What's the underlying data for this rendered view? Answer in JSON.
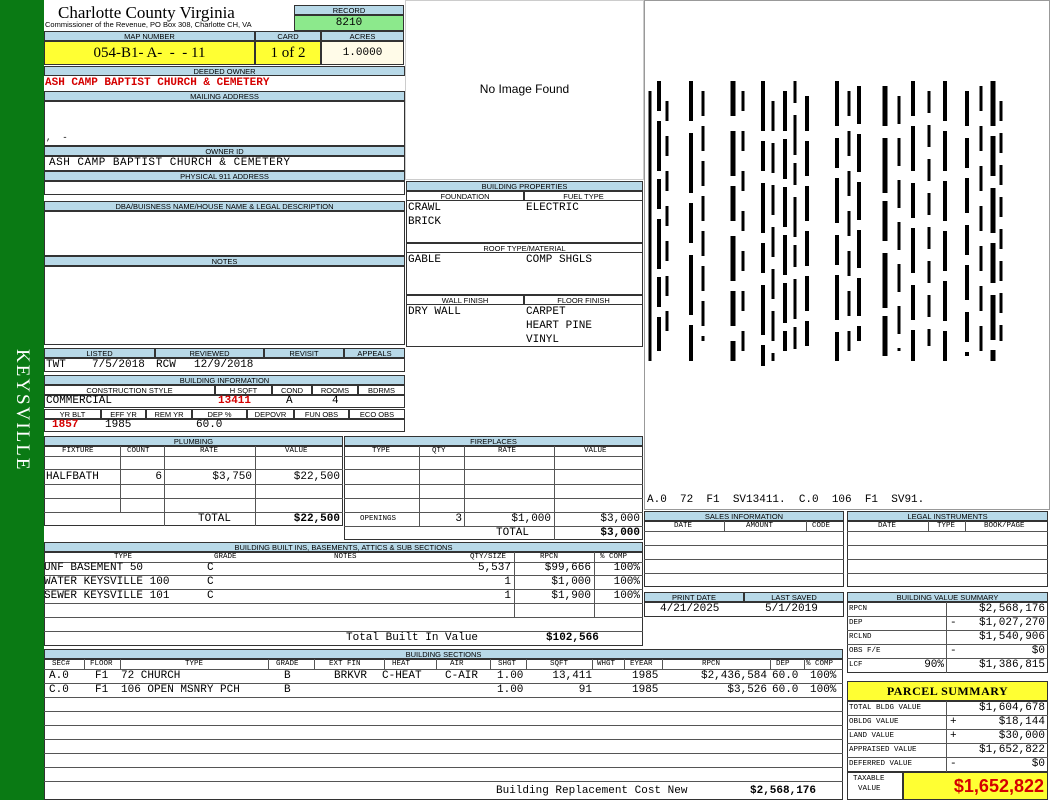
{
  "side": {
    "town": "KEYSVILLE"
  },
  "header": {
    "county": "Charlotte County Virginia",
    "address": "Commissioner of the Revenue, PO Box 308, Charlotte CH, VA",
    "record_label": "RECORD",
    "record": "8210",
    "map_label": "MAP NUMBER",
    "map": "054-B1- A-  -  - 11",
    "card_label": "CARD",
    "card": "1 of 2",
    "acres_label": "ACRES",
    "acres": "1.0000"
  },
  "owner": {
    "deeded_label": "DEEDED OWNER",
    "deeded": "ASH CAMP BAPTIST CHURCH & CEMETERY",
    "mailing_label": "MAILING ADDRESS",
    "mailing": ",  -",
    "owner_id_label": "OWNER ID",
    "owner_id": "ASH CAMP BAPTIST CHURCH & CEMETERY",
    "physical_label": "PHYSICAL 911 ADDRESS",
    "dba_label": "DBA/BUISNESS NAME/HOUSE NAME & LEGAL DESCRIPTION",
    "notes_label": "NOTES"
  },
  "photo": {
    "text": "No Image Found"
  },
  "sketch": {
    "caption": "A.0  72  F1  SV13411.  C.0  106  F1  SV91."
  },
  "props": {
    "title": "BUILDING PROPERTIES",
    "foundation_label": "FOUNDATION",
    "fuel_label": "FUEL TYPE",
    "foundation1": "CRAWL",
    "foundation2": "BRICK",
    "fuel": "ELECTRIC",
    "roof_label": "ROOF TYPE/MATERIAL",
    "roof1": "GABLE",
    "roof2": "COMP SHGLS",
    "wall_label": "WALL FINISH",
    "floor_label": "FLOOR FINISH",
    "wall": "DRY WALL",
    "floor1": "CARPET",
    "floor2": "HEART PINE",
    "floor3": "VINYL"
  },
  "visits": {
    "listed_label": "LISTED",
    "reviewed_label": "REVIEWED",
    "revisit_label": "REVISIT",
    "appeals_label": "APPEALS",
    "listed_by": "TWT",
    "listed": "7/5/2018",
    "reviewed_by": "RCW",
    "reviewed": "12/9/2018"
  },
  "binfo": {
    "title": "BUILDING INFORMATION",
    "style_label": "CONSTRUCTION STYLE",
    "hsqft_label": "H SQFT",
    "cond_label": "COND",
    "rooms_label": "ROOMS",
    "bdrms_label": "BDRMS",
    "style": "COMMERCIAL",
    "hsqft": "13411",
    "cond": "A",
    "rooms": "4",
    "yrblt_label": "YR BLT",
    "effyr_label": "EFF YR",
    "remyr_label": "REM YR",
    "dep_label": "DEP %",
    "depovr_label": "DEPOVR",
    "funobs_label": "FUN OBS",
    "ecoobs_label": "ECO OBS",
    "yrblt": "1857",
    "effyr": "1985",
    "dep": "60.0"
  },
  "plumbing": {
    "title": "PLUMBING",
    "cols": [
      "FIXTURE",
      "COUNT",
      "RATE",
      "VALUE"
    ],
    "fixture": "HALFBATH",
    "count": "6",
    "rate": "$3,750",
    "value": "$22,500",
    "total_label": "TOTAL",
    "total": "$22,500"
  },
  "fireplaces": {
    "title": "FIREPLACES",
    "cols": [
      "TYPE",
      "QTY",
      "RATE",
      "VALUE"
    ],
    "openings_label": "OPENINGS",
    "qty": "3",
    "rate": "$1,000",
    "value": "$3,000",
    "total_label": "TOTAL",
    "total": "$3,000"
  },
  "sales": {
    "title": "SALES INFORMATION",
    "cols": [
      "DATE",
      "AMOUNT",
      "CODE"
    ]
  },
  "legal": {
    "title": "LEGAL INSTRUMENTS",
    "cols": [
      "DATE",
      "TYPE",
      "BOOK/PAGE"
    ]
  },
  "dates": {
    "print_label": "PRINT DATE",
    "print": "4/21/2025",
    "saved_label": "LAST SAVED",
    "saved": "5/1/2019"
  },
  "builtins": {
    "title": "BUILDING BUILT INS, BASEMENTS, ATTICS & SUB SECTIONS",
    "cols": [
      "TYPE",
      "GRADE",
      "NOTES",
      "QTY/SIZE",
      "RPCN",
      "% COMP"
    ],
    "rows": [
      {
        "type": "50 UNF BASEMENT",
        "grade": "C",
        "qty": "5,537",
        "rpcn": "$99,666",
        "comp": "100%"
      },
      {
        "type": "100 WATER KEYSVILLE",
        "grade": "C",
        "qty": "1",
        "rpcn": "$1,000",
        "comp": "100%"
      },
      {
        "type": "101 SEWER KEYSVILLE",
        "grade": "C",
        "qty": "1",
        "rpcn": "$1,900",
        "comp": "100%"
      }
    ],
    "total_label": "Total Built In Value",
    "total": "$102,566"
  },
  "sections": {
    "title": "BUILDING SECTIONS",
    "cols": [
      "SEC#",
      "FLOOR",
      "TYPE",
      "GRADE",
      "EXT FIN",
      "HEAT",
      "AIR",
      "SHGT",
      "SQFT",
      "WHGT",
      "EYEAR",
      "RPCN",
      "DEP",
      "% COMP"
    ],
    "rows": [
      {
        "sec": "A.0",
        "floor": "F1",
        "type": "72 CHURCH",
        "grade": "B",
        "extfin": "BRKVR",
        "heat": "C-HEAT",
        "air": "C-AIR",
        "shgt": "1.00",
        "sqft": "13,411",
        "eyear": "1985",
        "rpcn": "$2,436,584",
        "dep": "60.0",
        "comp": "100%"
      },
      {
        "sec": "C.0",
        "floor": "F1",
        "type": "106 OPEN MSNRY PCH",
        "grade": "B",
        "extfin": "",
        "heat": "",
        "air": "",
        "shgt": "1.00",
        "sqft": "91",
        "eyear": "1985",
        "rpcn": "$3,526",
        "dep": "60.0",
        "comp": "100%"
      }
    ],
    "brcn_label": "Building Replacement Cost New",
    "brcn": "$2,568,176"
  },
  "bvs": {
    "title": "BUILDING VALUE SUMMARY",
    "rpcn_label": "RPCN",
    "rpcn": "$2,568,176",
    "dep_label": "DEP",
    "dep_sign": "-",
    "dep": "$1,027,270",
    "rclnd_label": "RCLND",
    "rclnd": "$1,540,906",
    "obs_label": "OBS F/E",
    "obs_sign": "-",
    "obs": "$0",
    "lcf_label": "LCF",
    "lcf_pct": "90%",
    "lcf": "$1,386,815"
  },
  "parcel": {
    "title": "PARCEL SUMMARY",
    "tbv_label": "TOTAL BLDG VALUE",
    "tbv": "$1,604,678",
    "obldg_label": "OBLDG VALUE",
    "obldg_sign": "+",
    "obldg": "$18,144",
    "land_label": "LAND VALUE",
    "land_sign": "+",
    "land": "$30,000",
    "appraised_label": "APPRAISED VALUE",
    "appraised": "$1,652,822",
    "deferred_label": "DEFERRED VALUE",
    "deferred_sign": "-",
    "deferred": "$0",
    "taxable_label1": "TAXABLE",
    "taxable_label2": "VALUE",
    "taxable": "$1,652,822"
  },
  "colors": {
    "sidebar": "#0a7a14",
    "header_bg": "#b8d9e8",
    "yellow": "#ffff33",
    "record_green": "#8ce98c",
    "red": "#d40000"
  }
}
